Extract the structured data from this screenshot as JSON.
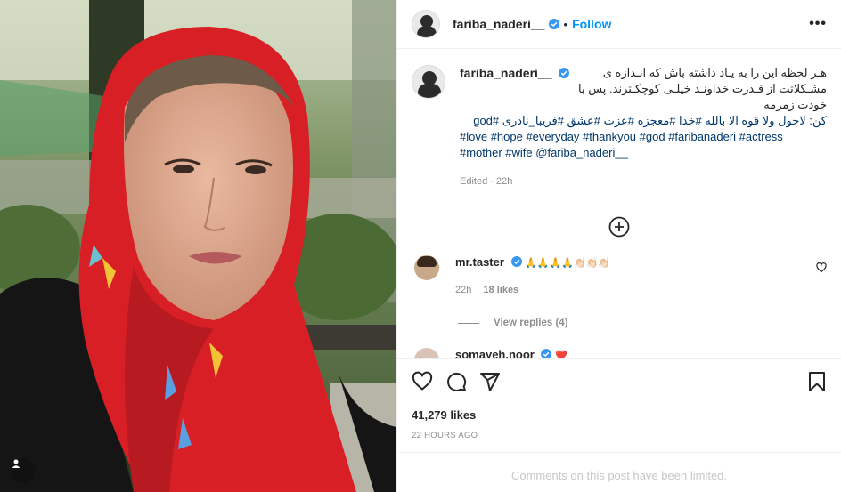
{
  "post": {
    "username": "fariba_naderi__",
    "follow_label": "Follow",
    "dot": "•",
    "more_label": "•••"
  },
  "caption": {
    "username": "fariba_naderi__",
    "line1": "هـر لحظه این را به یـاد داشته باش که انـدازه ی",
    "line2": "مشـکلاتت از قـدرت خداونـد خیلـی کوچکـترند. پس با خودت زمزمه",
    "line3": "کن: لاحول ولا قوه الا بالله #خدا #معجزه #عزت #عشق #فریبا_نادری #god",
    "line4": "#love #hope #everyday #thankyou #god #faribanaderi #actress",
    "line5": "#mother #wife @fariba_naderi__",
    "edited": "Edited · 22h"
  },
  "comment": {
    "username": "mr.taster",
    "text": "🙏🙏🙏🙏👏🏻👏🏻👏🏻",
    "time": "22h",
    "likes": "18 likes",
    "view_replies": "View replies (4)"
  },
  "comment2": {
    "username": "somayeh.noor",
    "text": "❤️"
  },
  "footer": {
    "likes": "41,279 likes",
    "ago": "22 HOURS AGO",
    "limited": "Comments on this post have been limited."
  },
  "colors": {
    "accent": "#0095f6",
    "verified": "#3897f0",
    "scarf": "#d81f26"
  }
}
